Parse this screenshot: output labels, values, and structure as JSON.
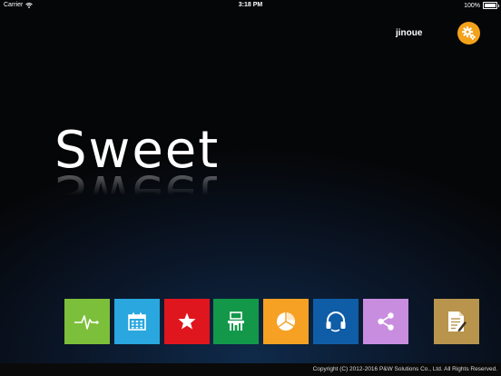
{
  "status_bar": {
    "carrier": "Carrier",
    "time": "3:18 PM",
    "battery": "100%",
    "battery_level": 1.0
  },
  "header": {
    "username": "jinoue",
    "settings_icon": "gear-icon"
  },
  "logo": {
    "text": "Sweet"
  },
  "tiles": [
    {
      "icon": "heartbeat-icon",
      "color": "#7cbf3a"
    },
    {
      "icon": "calendar-icon",
      "color": "#29a7de"
    },
    {
      "icon": "star-icon",
      "color": "#e0161e"
    },
    {
      "icon": "classroom-desk-icon",
      "color": "#13984a"
    },
    {
      "icon": "pie-chart-icon",
      "color": "#f6a123"
    },
    {
      "icon": "headset-icon",
      "color": "#0f5da7"
    },
    {
      "icon": "share-icon",
      "color": "#c98de0"
    },
    {
      "icon": "document-icon",
      "color": "#b8944d"
    }
  ],
  "footer": {
    "copyright": "Copyright (C) 2012-2016 P&W Solutions Co., Ltd. All Rights Reserved."
  }
}
